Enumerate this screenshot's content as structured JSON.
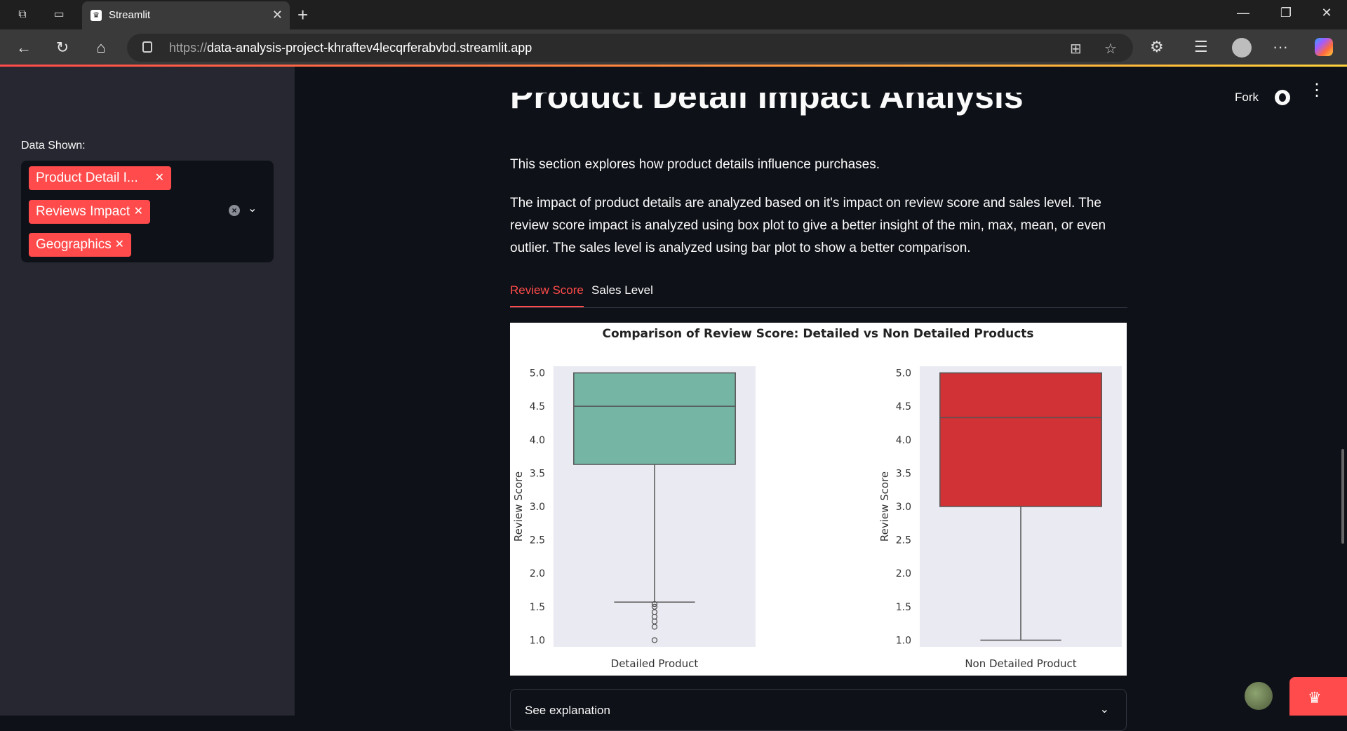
{
  "browser": {
    "tab_title": "Streamlit",
    "url_proto": "https://",
    "url_host": "data-analysis-project-khraftev4lecqrferabvbd.streamlit.app"
  },
  "sidebar": {
    "label": "Data Shown:",
    "chips": [
      {
        "label": "Product Detail I..."
      },
      {
        "label": "Reviews Impact"
      },
      {
        "label": "Geographics"
      }
    ]
  },
  "header": {
    "fork_label": "Fork"
  },
  "main": {
    "title": "Product Detail Impact Analysis",
    "intro": "This section explores how product details influence purchases.",
    "description": "The impact of product details are analyzed based on it's impact on review score and sales level. The review score impact is analyzed using box plot to give a better insight of the min, max, mean, or even outlier. The sales level is analyzed using bar plot to show a better comparison.",
    "tabs": [
      {
        "label": "Review Score",
        "active": true
      },
      {
        "label": "Sales Level",
        "active": false
      }
    ],
    "expander_label": "See explanation"
  },
  "colors": {
    "accent": "#ff4b4b",
    "box_detailed": "#74b5a3",
    "box_non_detailed": "#d03236",
    "plot_bg": "#eaeaf2"
  },
  "chart_data": {
    "type": "box",
    "title": "Comparison of Review Score: Detailed vs Non Detailed Products",
    "ylabel": "Review Score",
    "ylim": [
      0.9,
      5.1
    ],
    "yticks": [
      "5.0",
      "4.5",
      "4.0",
      "3.5",
      "3.0",
      "2.5",
      "2.0",
      "1.5",
      "1.0"
    ],
    "series": [
      {
        "name": "Detailed Product",
        "q1": 3.63,
        "median": 4.5,
        "q3": 5.0,
        "whisker_low": 1.57,
        "whisker_high": 5.0,
        "outliers": [
          1.0,
          1.2,
          1.28,
          1.35,
          1.42,
          1.5,
          1.54
        ],
        "color": "#74b5a3"
      },
      {
        "name": "Non Detailed Product",
        "q1": 3.0,
        "median": 4.33,
        "q3": 5.0,
        "whisker_low": 1.0,
        "whisker_high": 5.0,
        "outliers": [],
        "color": "#d03236"
      }
    ]
  }
}
